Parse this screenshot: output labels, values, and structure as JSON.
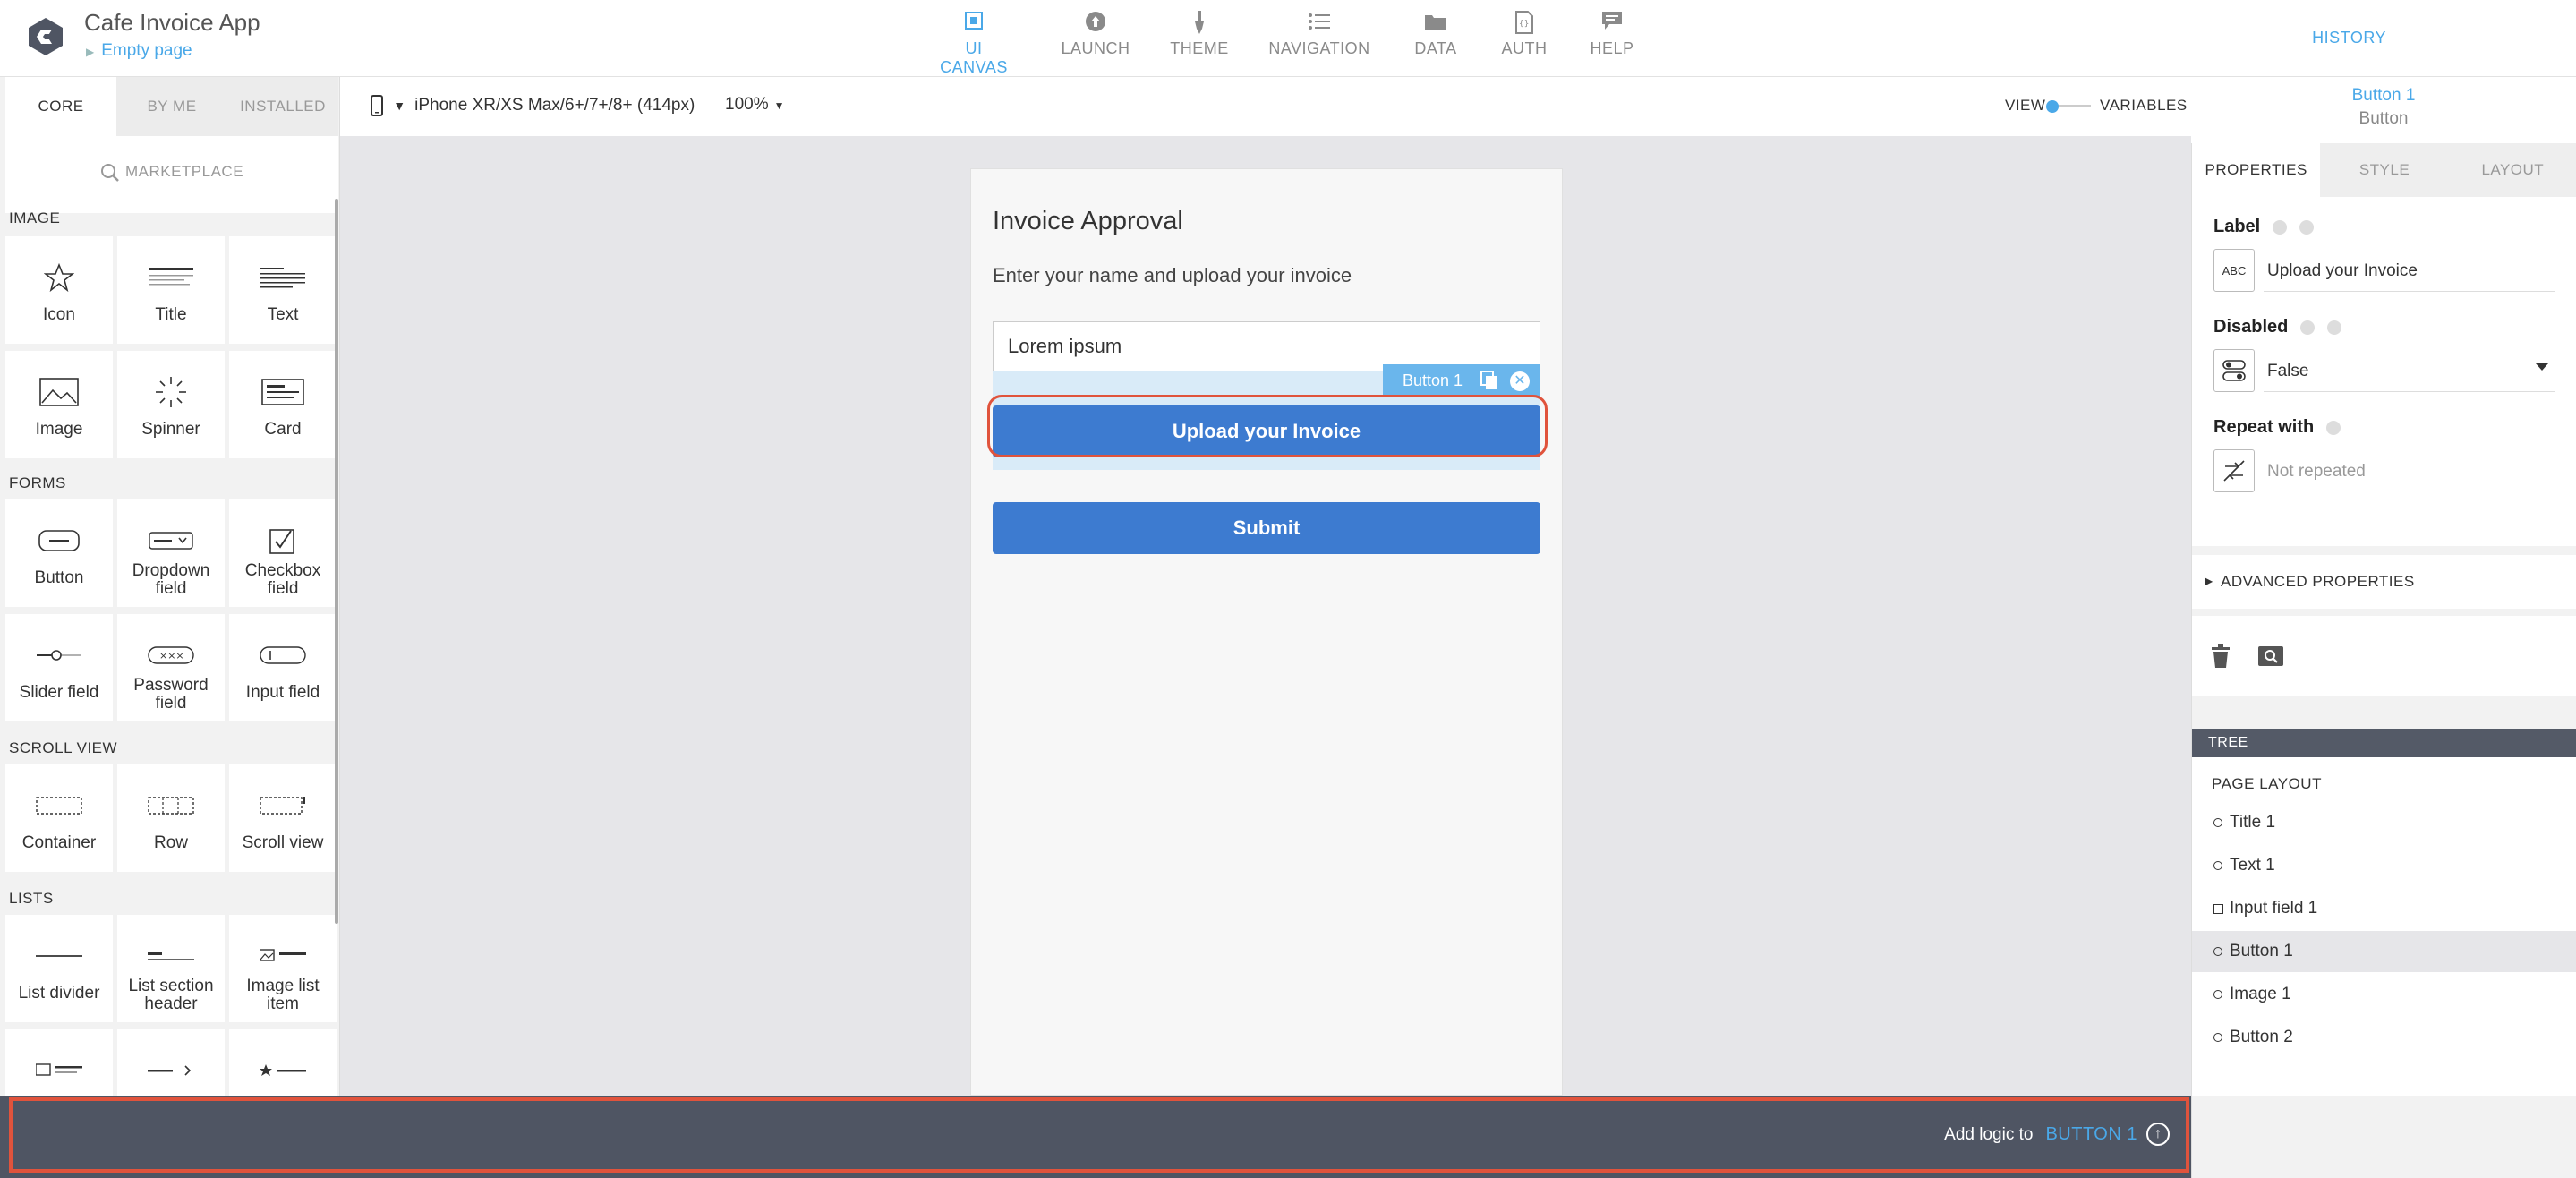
{
  "app": {
    "title": "Cafe Invoice App",
    "page": "Empty page"
  },
  "nav": [
    {
      "label": "UI CANVAS",
      "icon": "ui-canvas-icon",
      "active": true
    },
    {
      "label": "LAUNCH",
      "icon": "launch-icon"
    },
    {
      "label": "THEME",
      "icon": "theme-icon"
    },
    {
      "label": "NAVIGATION",
      "icon": "navigation-icon"
    },
    {
      "label": "DATA",
      "icon": "data-icon"
    },
    {
      "label": "AUTH",
      "icon": "auth-icon"
    },
    {
      "label": "HELP",
      "icon": "help-icon"
    }
  ],
  "history": "HISTORY",
  "left_panel": {
    "tabs": [
      "CORE",
      "BY ME",
      "INSTALLED"
    ],
    "marketplace": "MARKETPLACE",
    "sections": {
      "image": "IMAGE",
      "forms": "FORMS",
      "scroll_view": "SCROLL VIEW",
      "lists": "LISTS"
    },
    "components": {
      "icon": "Icon",
      "title": "Title",
      "text": "Text",
      "image": "Image",
      "spinner": "Spinner",
      "card": "Card",
      "button": "Button",
      "dropdown": "Dropdown field",
      "checkbox": "Checkbox field",
      "slider": "Slider field",
      "password": "Password field",
      "input": "Input field",
      "container": "Container",
      "row": "Row",
      "scrollview": "Scroll view",
      "list_divider": "List divider",
      "list_section_header": "List section header",
      "image_list_item": "Image list item"
    }
  },
  "toolbar": {
    "device": "iPhone XR/XS Max/6+/7+/8+ (414px)",
    "zoom": "100%",
    "view": "VIEW",
    "variables": "VARIABLES",
    "selected_name": "Button 1",
    "selected_type": "Button"
  },
  "phone": {
    "title": "Invoice Approval",
    "text": "Enter your name and upload your invoice",
    "input_value": "Lorem ipsum",
    "selection_tag": "Button 1",
    "button1": "Upload your Invoice",
    "button2": "Submit"
  },
  "right_panel": {
    "tabs": [
      "PROPERTIES",
      "STYLE",
      "LAYOUT"
    ],
    "label_title": "Label",
    "label_value": "Upload your Invoice",
    "label_icon_text": "ABC",
    "disabled_title": "Disabled",
    "disabled_value": "False",
    "repeat_title": "Repeat with",
    "repeat_value": "Not repeated",
    "advanced": "ADVANCED PROPERTIES",
    "tree_header": "TREE",
    "tree_title": "PAGE LAYOUT",
    "tree_nodes": [
      "Title 1",
      "Text 1",
      "Input field 1",
      "Button 1",
      "Image 1",
      "Button 2"
    ]
  },
  "bottom": {
    "prefix": "Add logic to",
    "target": "BUTTON 1"
  },
  "colors": {
    "accent": "#4aa8e8",
    "button": "#3d7bd0",
    "highlight": "#e0533c",
    "bottom_bar": "#4f5563"
  }
}
